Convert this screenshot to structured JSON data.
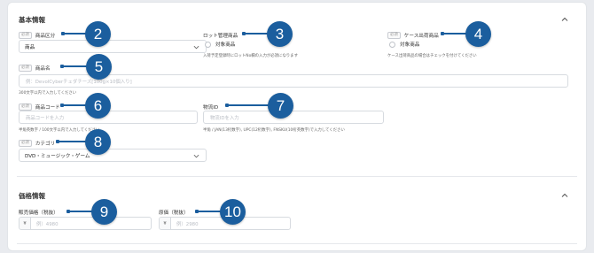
{
  "basic_section": {
    "title": "基本情報"
  },
  "price_section": {
    "title": "価格情報"
  },
  "required_tag": "必須",
  "fields": {
    "product_category": {
      "label": "商品区分",
      "value": "商品"
    },
    "lot_managed": {
      "label": "ロット管理商品",
      "checkbox_label": "対象商品",
      "hint": "入荷予定登録時にロットNo欄の入力が必須になります"
    },
    "case_shipping": {
      "label": "ケース出荷商品",
      "checkbox_label": "対象商品",
      "hint": "ケース出荷商品の場合はチェックを付けてください"
    },
    "product_name": {
      "label": "商品名",
      "placeholder": "例：DevolCyberチェダチーズ[100g×10個入り]",
      "hint": "300文字以内で入力してください"
    },
    "product_code": {
      "label": "商品コード",
      "placeholder": "商品コードを入力",
      "hint": "半角英数字 / 100文字以内で入力してください"
    },
    "logistics_id": {
      "label": "物流ID",
      "placeholder": "物流IDを入力",
      "hint": "半角 / JAN(13桁数字), UPC(12桁数字), FNSKU(10桁英数字)で入力してください"
    },
    "category": {
      "label": "カテゴリ",
      "value": "DVD・ミュージック・ゲーム"
    },
    "sale_price": {
      "label": "販売価格（税抜）",
      "currency": "¥",
      "placeholder": "例）4980"
    },
    "cost_price": {
      "label": "原価（税抜）",
      "currency": "¥",
      "placeholder": "例）2980"
    }
  },
  "callouts": [
    "2",
    "3",
    "4",
    "5",
    "6",
    "7",
    "8",
    "9",
    "10"
  ],
  "colors": {
    "callout": "#1b5e9e",
    "border": "#d7dbe0"
  }
}
